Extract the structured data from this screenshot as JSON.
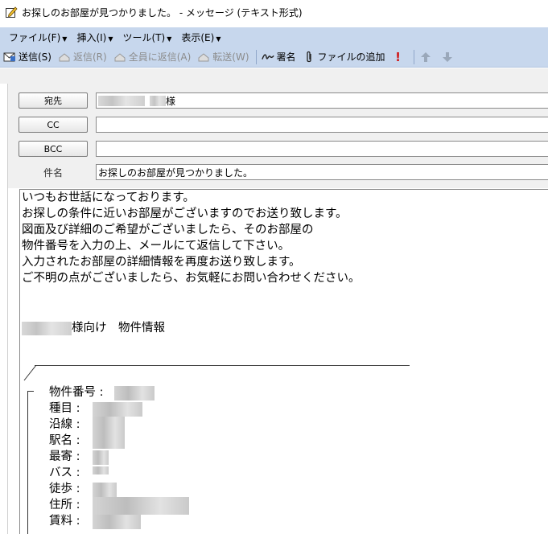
{
  "window": {
    "title": "お探しのお部屋が見つかりました。 - メッセージ (テキスト形式)"
  },
  "menu": [
    {
      "label": "ファイル(F)",
      "icon": "chevron-down-icon"
    },
    {
      "label": "挿入(I)",
      "icon": "chevron-down-icon"
    },
    {
      "label": "ツール(T)",
      "icon": "chevron-down-icon"
    },
    {
      "label": "表示(E)",
      "icon": "chevron-down-icon"
    }
  ],
  "toolbar": {
    "send": "送信(S)",
    "reply": "返信(R)",
    "reply_all": "全員に返信(A)",
    "forward": "転送(W)",
    "signature": "署名",
    "attach": "ファイルの追加"
  },
  "header": {
    "to_button": "宛先",
    "to_value": "様",
    "cc_button": "CC",
    "cc_value": "",
    "bcc_button": "BCC",
    "bcc_value": "",
    "subject_label": "件名",
    "subject_value": "お探しのお部屋が見つかりました。"
  },
  "body": {
    "lines": [
      "いつもお世話になっております。",
      "お探しの条件に近いお部屋がございますのでお送り致します。",
      "図面及び詳細のご希望がございましたら、そのお部屋の",
      "物件番号を入力の上、メールにて返信して下さい。",
      "入力されたお部屋の詳細情報を再度お送り致します。",
      "ご不明の点がございましたら、お気軽にお問い合わせください。"
    ],
    "recipient_suffix": "様向け　物件情報",
    "properties": [
      "物件番号 :",
      "種目 :",
      "沿線 :",
      "駅名 :",
      "最寄 :",
      "バス :",
      "徒歩 :",
      "住所 :",
      "賃料 :"
    ]
  },
  "colors": {
    "menubar_bg": "#c7d7ed",
    "header_bg": "#f0f0f0",
    "flag_red": "#d01818",
    "arrow_gray": "#9aa8ba"
  }
}
